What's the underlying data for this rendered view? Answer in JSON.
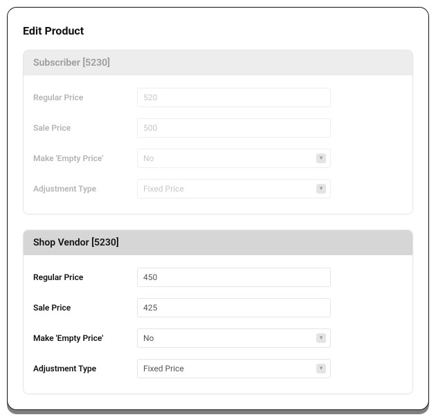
{
  "page_title": "Edit Product",
  "sections": [
    {
      "header": "Subscriber [5230]",
      "regular_price_label": "Regular Price",
      "regular_price_value": "520",
      "sale_price_label": "Sale Price",
      "sale_price_value": "500",
      "empty_price_label": "Make 'Empty Price'",
      "empty_price_value": "No",
      "adjustment_label": "Adjustment Type",
      "adjustment_value": "Fixed Price",
      "emphasis": "muted"
    },
    {
      "header": "Shop Vendor [5230]",
      "regular_price_label": "Regular Price",
      "regular_price_value": "450",
      "sale_price_label": "Sale Price",
      "sale_price_value": "425",
      "empty_price_label": "Make 'Empty Price'",
      "empty_price_value": "No",
      "adjustment_label": "Adjustment Type",
      "adjustment_value": "Fixed Price",
      "emphasis": "active"
    }
  ]
}
